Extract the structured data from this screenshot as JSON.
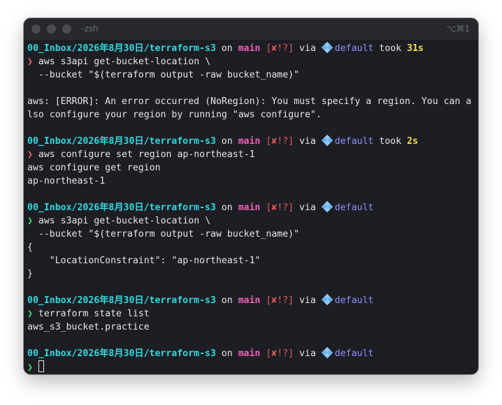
{
  "window": {
    "title": "-zsh",
    "shortcut": "⌥⌘1"
  },
  "colors": {
    "path": "#34d9e0",
    "branch": "#f25fb8",
    "git_status": "#e8565e",
    "aws_profile": "#8d92ff",
    "duration": "#f0e04a",
    "prompt_ok": "#3fe27a",
    "prompt_error": "#ff5f6a",
    "background": "#1c1e23"
  },
  "prompt": {
    "path": "00_Inbox/2026年8月30日/terraform-s3",
    "on": "on",
    "branch_icon": "",
    "branch": "main",
    "git_status": "[✘!?]",
    "via": "via",
    "aws_icon": "aws-cube-icon",
    "profile": "default",
    "took": "took",
    "symbol": "❯"
  },
  "blocks": [
    {
      "duration": "31s",
      "command": [
        "aws s3api get-bucket-location \\",
        "  --bucket \"$(terraform output -raw bucket_name)\""
      ],
      "output": [
        "",
        "aws: [ERROR]: An error occurred (NoRegion): You must specify a region. You can a",
        "lso configure your region by running \"aws configure\".",
        ""
      ]
    },
    {
      "duration": "2s",
      "command": [
        "aws configure set region ap-northeast-1"
      ],
      "output": [
        "aws configure get region",
        "ap-northeast-1",
        ""
      ]
    },
    {
      "command": [
        "aws s3api get-bucket-location \\",
        "  --bucket \"$(terraform output -raw bucket_name)\""
      ],
      "output": [
        "{",
        "    \"LocationConstraint\": \"ap-northeast-1\"",
        "}",
        ""
      ]
    },
    {
      "command": [
        "terraform state list"
      ],
      "output": [
        "aws_s3_bucket.practice",
        ""
      ]
    },
    {
      "command": [
        ""
      ],
      "output": [],
      "active": true
    }
  ]
}
